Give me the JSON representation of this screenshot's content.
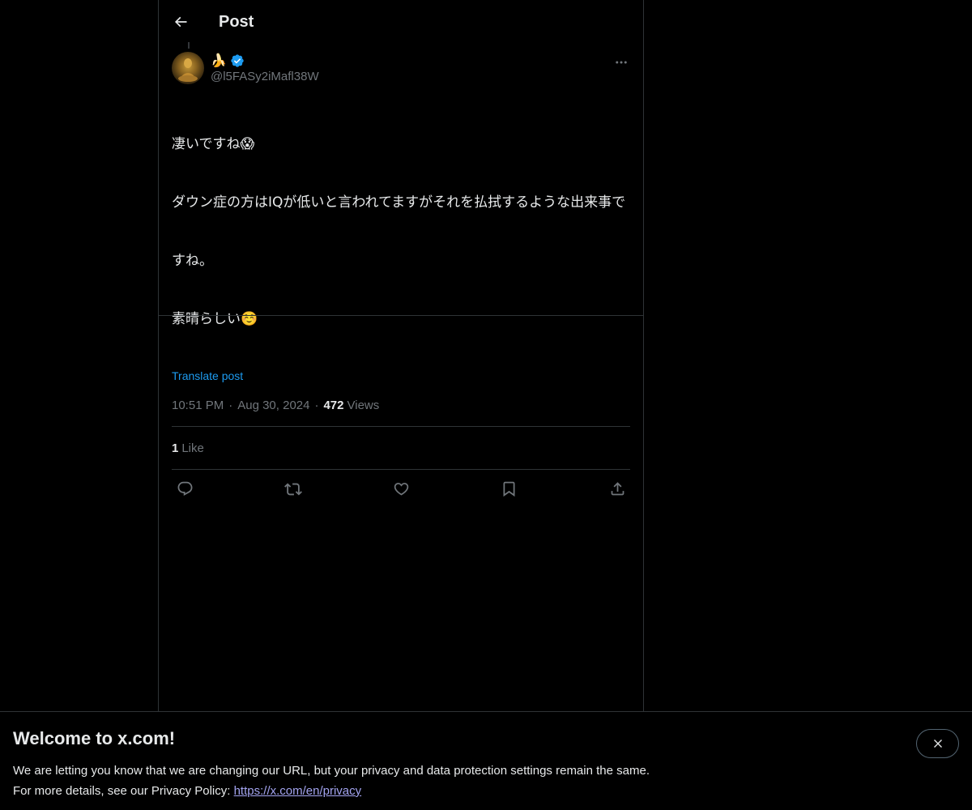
{
  "header": {
    "title": "Post"
  },
  "post": {
    "display_name": "🍌",
    "handle": "@l5FASy2iMafl38W",
    "text_lines": [
      "凄いですね😱",
      "ダウン症の方はIQが低いと言われてますがそれを払拭するような出来事で",
      "すね。",
      "素晴らしい☺️"
    ],
    "translate_label": "Translate post",
    "time": "10:51 PM",
    "date": "Aug 30, 2024",
    "views_count": "472",
    "views_label": "Views",
    "likes_count": "1",
    "likes_label": "Like"
  },
  "banner": {
    "title": "Welcome to x.com!",
    "line1": "We are letting you know that we are changing our URL, but your privacy and data protection settings remain the same.",
    "line2_prefix": "For more details, see our Privacy Policy: ",
    "link": "https://x.com/en/privacy"
  },
  "colors": {
    "accent": "#1d9bf0",
    "background": "#000000",
    "border": "#2f3336",
    "muted": "#71767b"
  }
}
